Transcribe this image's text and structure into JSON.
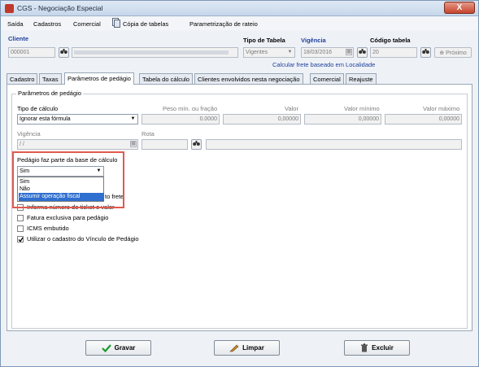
{
  "window": {
    "title": "CGS - Negociação Especial",
    "close_label": "X"
  },
  "menu": [
    "Saída",
    "Cadastros",
    "Comercial",
    "Cópia de tabelas",
    "Parametrização de rateio"
  ],
  "header": {
    "cliente_label": "Cliente",
    "cliente_code": "000001",
    "tipo_tabela_label": "Tipo de Tabela",
    "tipo_tabela_value": "Vigentes",
    "vigencia_label": "Vigência",
    "vigencia_value": "18/03/2016",
    "codigo_tabela_label": "Código tabela",
    "codigo_tabela_value": "20",
    "proximo_label": "Próximo",
    "calc_note": "Calcular frete baseado em Localidade"
  },
  "tabs": [
    "Cadastro",
    "Taxas",
    "Parâmetros de pedágio",
    "Tabela do cálculo",
    "Clientes envolvidos nesta negociação",
    "Comercial",
    "Reajuste"
  ],
  "params": {
    "group_title": "Parâmetros de pedágio",
    "tipo_calculo_label": "Tipo de cálculo",
    "tipo_calculo_value": "Ignorar esta fórmula",
    "peso_label": "Peso mín. ou fração",
    "peso_value": "0.0000",
    "valor_label": "Valor",
    "valor_value": "0,00000",
    "valor_min_label": "Valor mínimo",
    "valor_min_value": "0,00000",
    "valor_max_label": "Valor máximo",
    "valor_max_value": "0,00000",
    "vigencia_label": "Vigência",
    "vigencia_value": "/ /",
    "rota_label": "Rota",
    "pedagio_base_label": "Pedágio faz parte da base de cálculo",
    "pedagio_base_value": "Sim",
    "options": [
      "Sim",
      "Não",
      "Assumir operação fiscal"
    ],
    "frete_partial": "to frete",
    "ticket_label": "Informa número do ticket e valor",
    "fatura_label": "Fatura exclusiva para pedágio",
    "icms_label": "ICMS embutido",
    "vinculo_label": "Utilizar o cadastro do Vínculo de Pedágio"
  },
  "footer": {
    "gravar": "Gravar",
    "limpar": "Limpar",
    "excluir": "Excluir"
  }
}
